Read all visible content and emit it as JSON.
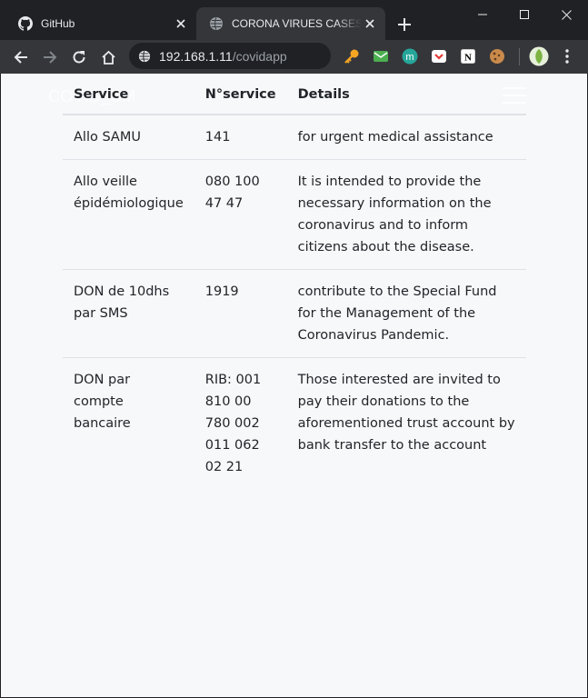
{
  "browser": {
    "tabs": [
      {
        "label": "GitHub",
        "icon": "github-icon"
      },
      {
        "label": "CORONA VIRUES CASES - M",
        "icon": "globe-icon"
      }
    ],
    "url_host": "192.168.1.11",
    "url_path": "/covidapp"
  },
  "page": {
    "brand": "COVID_SM"
  },
  "table": {
    "headers": [
      "Service",
      "N°service",
      "Details"
    ],
    "rows": [
      {
        "service": "Allo SAMU",
        "number": "141",
        "details": "for urgent medical assistance"
      },
      {
        "service": "Allo veille épidémiologique",
        "number": "080 100 47 47",
        "details": "It is intended to provide the necessary information on the coronavirus and to inform citizens about the disease."
      },
      {
        "service": "DON de 10dhs par SMS",
        "number": "1919",
        "details": "contribute to the Special Fund for the Management of the Coronavirus Pandemic."
      },
      {
        "service": "DON par compte bancaire",
        "number": "RIB: 001 810 00 780 002 011 062 02 21",
        "details": "Those interested are invited to pay their donations to the aforementioned trust account by bank transfer to the account"
      }
    ]
  }
}
